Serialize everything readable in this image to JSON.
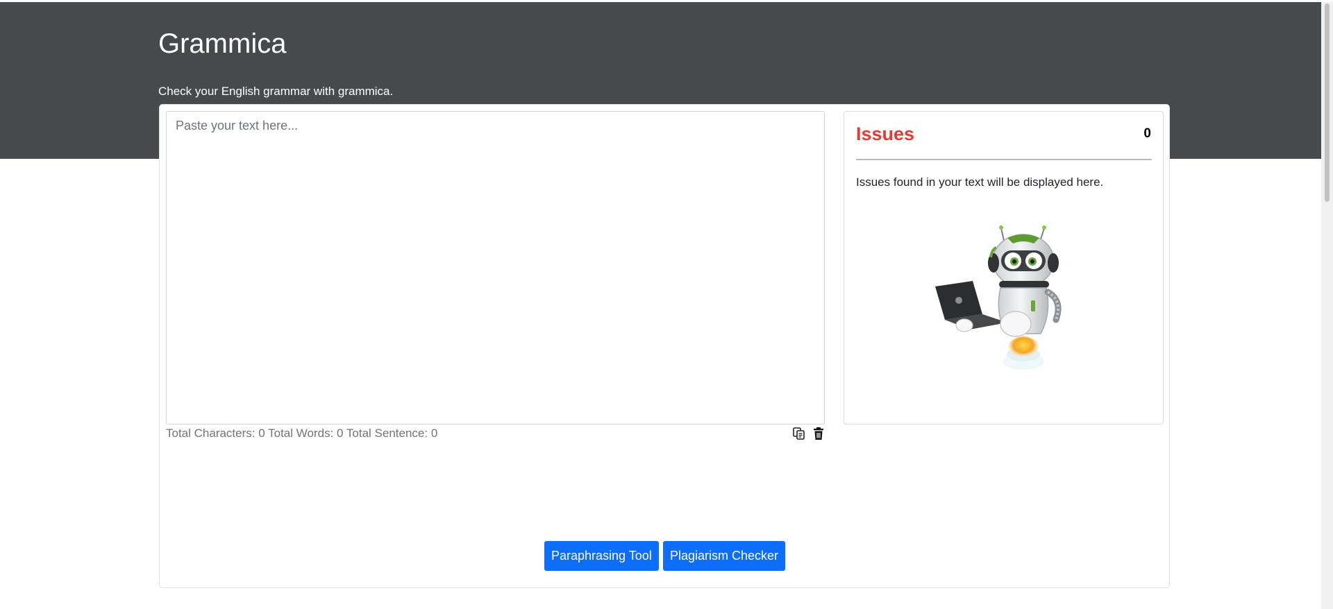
{
  "header": {
    "brand": "Grammica",
    "tagline": "Check your English grammar with grammica."
  },
  "editor": {
    "placeholder": "Paste your text here...",
    "value": ""
  },
  "stats": {
    "characters_label": "Total Characters:",
    "characters": "0",
    "words_label": "Total Words:",
    "words": "0",
    "sentences_label": "Total Sentence:",
    "sentences": "0"
  },
  "toolbar": {
    "copy_icon": "copy-icon",
    "delete_icon": "trash-icon"
  },
  "issues": {
    "title": "Issues",
    "count": "0",
    "message": "Issues found in your text will be displayed here.",
    "illustration_icon": "robot-with-laptop-icon"
  },
  "actions": {
    "paraphrasing_label": "Paraphrasing Tool",
    "plagiarism_label": "Plagiarism Checker"
  },
  "colors": {
    "header_bg": "#474a4d",
    "issues_title": "#e63a34",
    "button_bg": "#0d6efd"
  }
}
